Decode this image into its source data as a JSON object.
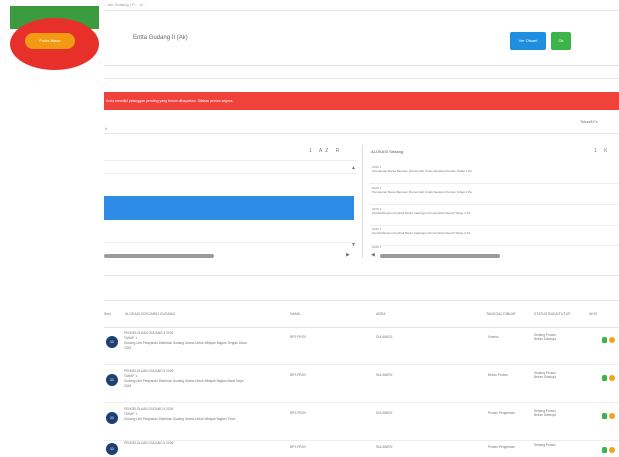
{
  "header": {
    "breadcrumb": "…ktu Gudang | P… Iz…",
    "logo_text": "Fruits Wave",
    "title": "Entta Gudang II (Ak)",
    "btn_primary": "Ver Ofsaet",
    "btn_success": "Ok"
  },
  "alert": {
    "text": "Anda memiliki pelanggan pending yang belum dibayarkan. Silakan proses segera."
  },
  "filter": {
    "left_small": "b",
    "label": "Tahun/8  Fs"
  },
  "left_box": {
    "controls": "1  AZ  R",
    "up_arrow": "▲",
    "down_arrow": "▼",
    "scroll_arrow": "▶"
  },
  "right_box": {
    "title": "ALOKASI Sedang",
    "controls": "1  K",
    "scroll_arrow": "◀",
    "items": [
      {
        "a": "2026 1",
        "b": "Penyaluran Beras Bantuan Pemerintah Untuk Sasaran Periode Tahap 1 Pa"
      },
      {
        "a": "2026 1",
        "b": "Penyaluran Beras Bantuan Pemerintah Untuk Sasaran Periode Tahap 2 Pa"
      },
      {
        "a": "2026 1",
        "b": "Pendistribusian Kembali Beras Cadangan Pemerintah Daerah Tahap 1 Pa"
      },
      {
        "a": "2026 1",
        "b": "Pendistribusian Kembali Beras Cadangan Pemerintah Daerah Tahap 2 Pa"
      },
      {
        "a": "2026 1",
        "b": ""
      }
    ]
  },
  "table": {
    "headers": [
      "Sesi",
      "ALOKASI DOKUMEN GUDANG",
      "NAMA",
      "AREA",
      "TANGGAL DIBUAT",
      "STATUS BUKA/TUTUP",
      "AKSI"
    ],
    "rows": [
      {
        "num": "11",
        "line1": "PENGELOLAAN GUDANG II 2026",
        "line2": "TAHAP 1",
        "line3": "Gudang Unit Pelayanan Distribusi Gudang Utama Untuk Wilayah Bagian Tengah Utara",
        "line4": "2026",
        "nama": "BPS PROV",
        "area": "SULAWESI",
        "tanggal": "Selesai",
        "status1": "Sedang Proses",
        "status2": "Belum Disetujui"
      },
      {
        "num": "11",
        "line1": "PENGELOLAAN GUDANG II 2026",
        "line2": "TAHAP 1",
        "line3": "Gudang Unit Pelayanan Distribusi Gudang Utama Untuk Wilayah Bagian Barat Daya",
        "line4": "2026",
        "nama": "BPS PROV",
        "area": "SULAWESI",
        "tanggal": "Belum Proses",
        "status1": "Sedang Proses",
        "status2": "Belum Disetujui"
      },
      {
        "num": "11",
        "line1": "PENGELOLAAN GUDANG II 2026",
        "line2": "TAHAP 1",
        "line3": "Gudang Unit Pelayanan Distribusi Gudang Utama Untuk Wilayah Bagian Timur",
        "line4": "",
        "nama": "BPS PROV",
        "area": "SULAWESI",
        "tanggal": "Proses Pengiriman",
        "status1": "Sedang Proses",
        "status2": "Belum Disetujui"
      },
      {
        "num": "11",
        "line1": "PENGELOLAAN GUDANG II 2026",
        "line2": "",
        "line3": "",
        "line4": "",
        "nama": "BPS PROV",
        "area": "SULAWESI",
        "tanggal": "Proses Pengiriman",
        "status1": "Sedang Proses",
        "status2": ""
      }
    ]
  }
}
